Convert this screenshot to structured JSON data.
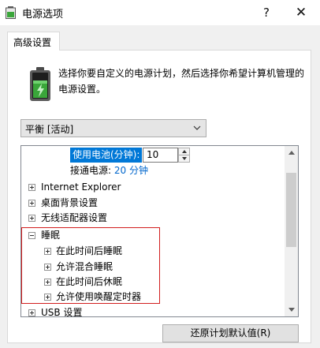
{
  "window": {
    "title": "电源选项",
    "help_glyph": "?",
    "close_glyph": "✕"
  },
  "tab": {
    "label": "高级设置"
  },
  "description": "选择你要自定义的电源计划，然后选择你希望计算机管理的电源设置。",
  "plan_select": {
    "value": "平衡 [活动]"
  },
  "tree": {
    "sub_setting": {
      "label": "使用电池(分钟):",
      "value": "10",
      "plugged_label": "接通电源:",
      "plugged_value": "20 分钟"
    },
    "items": [
      {
        "label": "Internet Explorer",
        "expanded": false,
        "level": 0
      },
      {
        "label": "桌面背景设置",
        "expanded": false,
        "level": 0
      },
      {
        "label": "无线适配器设置",
        "expanded": false,
        "level": 0
      },
      {
        "label": "睡眠",
        "expanded": true,
        "level": 0
      },
      {
        "label": "在此时间后睡眠",
        "expanded": false,
        "level": 1
      },
      {
        "label": "允许混合睡眠",
        "expanded": false,
        "level": 1
      },
      {
        "label": "在此时间后休眠",
        "expanded": false,
        "level": 1
      },
      {
        "label": "允许使用唤醒定时器",
        "expanded": false,
        "level": 1
      },
      {
        "label": "USB 设置",
        "expanded": false,
        "level": 0
      }
    ]
  },
  "buttons": {
    "restore_defaults": "还原计划默认值(R)"
  },
  "colors": {
    "selection": "#0078d7",
    "link_value": "#0066cc",
    "highlight_border": "#d21e1e",
    "battery_green": "#3aa63a"
  },
  "icons": {
    "app": "power-options-icon",
    "battery": "battery-icon",
    "dropdown": "chevron-down-icon",
    "expand": "plus-box-icon",
    "collapse": "minus-box-icon"
  }
}
